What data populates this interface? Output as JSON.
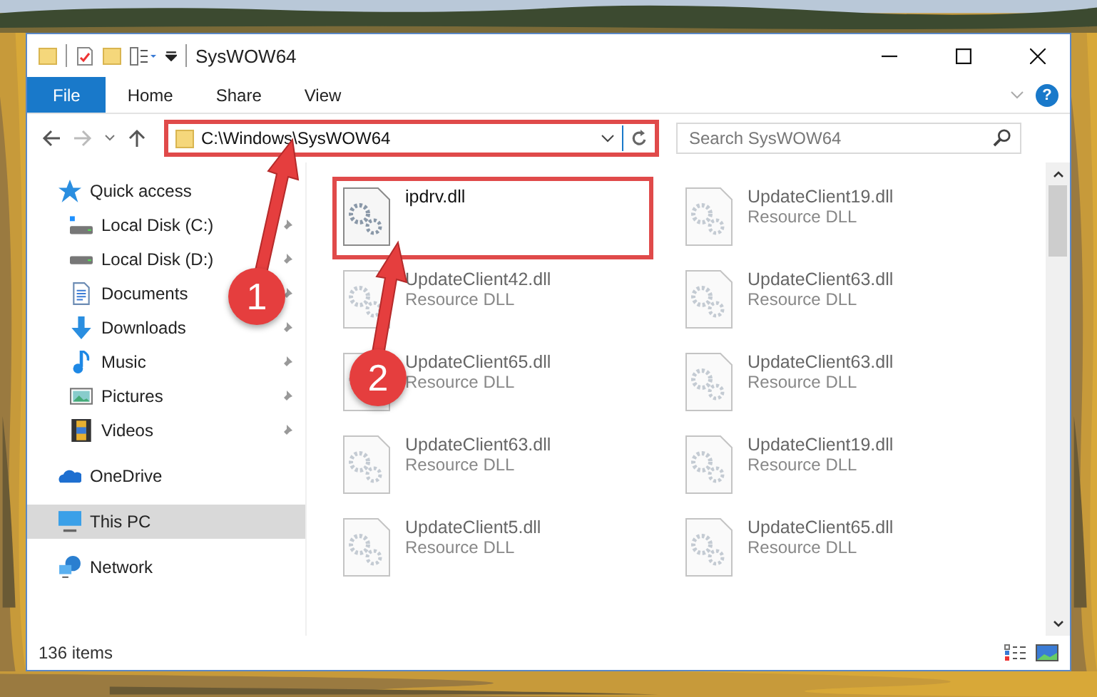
{
  "window": {
    "title": "SysWOW64"
  },
  "ribbon": {
    "tabs": [
      {
        "label": "File",
        "selected": true
      },
      {
        "label": "Home",
        "selected": false
      },
      {
        "label": "Share",
        "selected": false
      },
      {
        "label": "View",
        "selected": false
      }
    ],
    "help": "?"
  },
  "address": {
    "path": "C:\\Windows\\SysWOW64",
    "highlighted": true
  },
  "search": {
    "placeholder": "Search SysWOW64"
  },
  "sidebar": {
    "items": [
      {
        "label": "Quick access",
        "selected": false,
        "children": [
          {
            "label": "Local Disk (C:)",
            "pinned": true,
            "selected": false
          },
          {
            "label": "Local Disk (D:)",
            "pinned": true,
            "selected": false
          },
          {
            "label": "Documents",
            "pinned": true,
            "selected": false
          },
          {
            "label": "Downloads",
            "pinned": true,
            "selected": false
          },
          {
            "label": "Music",
            "pinned": true,
            "selected": false
          },
          {
            "label": "Pictures",
            "pinned": true,
            "selected": false
          },
          {
            "label": "Videos",
            "pinned": true,
            "selected": false
          }
        ]
      },
      {
        "label": "OneDrive",
        "selected": false
      },
      {
        "label": "This PC",
        "selected": true
      },
      {
        "label": "Network",
        "selected": false
      }
    ]
  },
  "files": [
    {
      "name": "ipdrv.dll",
      "highlighted": true
    },
    {
      "name": "UpdateClient19.dll",
      "type": "Resource DLL",
      "highlighted": false
    },
    {
      "name": "UpdateClient42.dll",
      "type": "Resource DLL",
      "highlighted": false
    },
    {
      "name": "UpdateClient63.dll",
      "type": "Resource DLL",
      "highlighted": false
    },
    {
      "name": "UpdateClient65.dll",
      "type": "Resource DLL",
      "highlighted": false
    },
    {
      "name": "UpdateClient63.dll",
      "type": "Resource DLL",
      "highlighted": false
    },
    {
      "name": "UpdateClient63.dll",
      "type": "Resource DLL",
      "highlighted": false
    },
    {
      "name": "UpdateClient19.dll",
      "type": "Resource DLL",
      "highlighted": false
    },
    {
      "name": "UpdateClient5.dll",
      "type": "Resource DLL",
      "highlighted": false
    },
    {
      "name": "UpdateClient65.dll",
      "type": "Resource DLL",
      "highlighted": false
    }
  ],
  "status_bar": {
    "item_count": "136 items"
  },
  "callouts": [
    {
      "label": "1"
    },
    {
      "label": "2"
    }
  ]
}
